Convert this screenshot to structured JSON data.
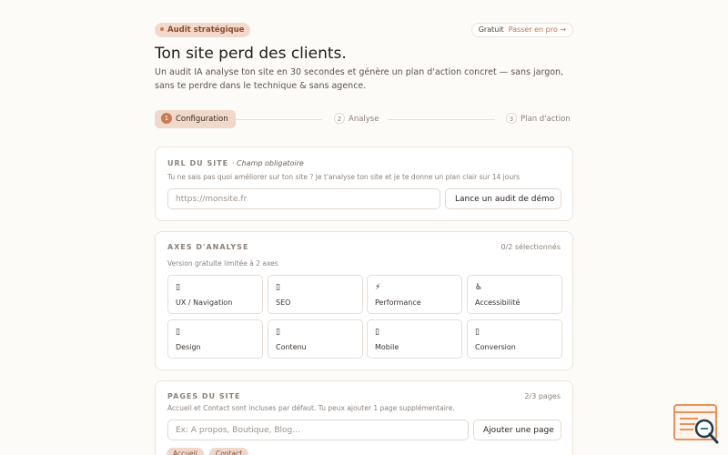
{
  "header": {
    "badge": "Audit stratégique",
    "plan_label": "Gratuit",
    "upgrade_link": "Passer en pro →",
    "title": "Ton site perd des clients.",
    "subtitle": "Un audit IA analyse ton site en 30 secondes et génère un plan d'action concret — sans jargon, sans te perdre dans le technique & sans agence."
  },
  "stepper": {
    "steps": [
      {
        "num": "1",
        "label": "Configuration",
        "active": true
      },
      {
        "num": "2",
        "label": "Analyse",
        "active": false
      },
      {
        "num": "3",
        "label": "Plan d'action",
        "active": false
      }
    ]
  },
  "url_card": {
    "label": "URL DU SITE",
    "required": "· Champ obligatoire",
    "hint": "Tu ne sais pas quoi améliorer sur ton site ? Je t'analyse ton site et je te donne un plan clair sur 14 jours",
    "placeholder": "https://monsite.fr",
    "demo_button": "Lance un audit de démo"
  },
  "axes_card": {
    "label": "AXES D'ANALYSE",
    "count": "0/2 sélectionnés",
    "hint": "Version gratuite limitée à 2 axes",
    "axes": [
      {
        "icon": "compass-icon",
        "glyph": "▯",
        "label": "UX / Navigation"
      },
      {
        "icon": "search-icon",
        "glyph": "▯",
        "label": "SEO"
      },
      {
        "icon": "lightning-icon",
        "glyph": "⚡",
        "label": "Performance"
      },
      {
        "icon": "accessibility-icon",
        "glyph": "♿",
        "label": "Accessibilité"
      },
      {
        "icon": "palette-icon",
        "glyph": "▯",
        "label": "Design"
      },
      {
        "icon": "document-icon",
        "glyph": "▯",
        "label": "Contenu"
      },
      {
        "icon": "mobile-icon",
        "glyph": "▯",
        "label": "Mobile"
      },
      {
        "icon": "target-icon",
        "glyph": "▯",
        "label": "Conversion"
      }
    ]
  },
  "pages_card": {
    "label": "PAGES DU SITE",
    "count": "2/3 pages",
    "hint": "Accueil et Contact sont incluses par défaut. Tu peux ajouter 1 page supplémentaire.",
    "placeholder": "Ex: À propos, Boutique, Blog...",
    "add_button": "Ajouter une page",
    "chips": [
      "Accueil",
      "Contact"
    ]
  },
  "colors": {
    "accent": "#c97a55",
    "accent_soft": "#f0d8ca",
    "background": "#fdfbf8"
  },
  "widget": {
    "icon": "search-report-icon"
  }
}
